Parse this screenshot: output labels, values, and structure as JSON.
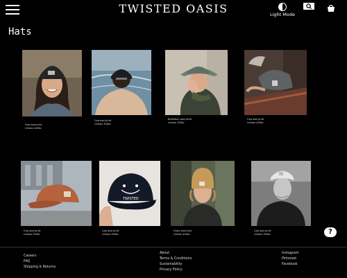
{
  "header": {
    "brand": "TWISTED OASIS",
    "light_mode_label": "Light Mode"
  },
  "page": {
    "title": "Hats"
  },
  "products": [
    {
      "line1": "Hue ead print",
      "line2": "Unisex 400kr."
    },
    {
      "line1": "Cap aad print",
      "line2": "Unisex 350kr."
    },
    {
      "line1": "Balliebun aad print",
      "line2": "Unisex 350kr."
    },
    {
      "line1": "Cap aad print",
      "line2": "Unisex 400kr."
    },
    {
      "line1": "Cap aad print",
      "line2": "Unisex 350kr."
    },
    {
      "line1": "Cap aad print",
      "line2": "Unisex 500kr."
    },
    {
      "line1": "Huey aad print",
      "line2": "Unisex 450kr."
    },
    {
      "line1": "Cap aad print",
      "line2": "Unisex 350kr."
    }
  ],
  "help": {
    "label": "?"
  },
  "footer": {
    "col1": [
      "Careers",
      "FAQ",
      "Shipping & Returns"
    ],
    "col2": [
      "About",
      "Terms & Conditions",
      "Sustainability",
      "Privacy Policy"
    ],
    "col3": [
      "Instagram",
      "Pinterest",
      "Facebook"
    ]
  },
  "colors": {
    "background": "#000000",
    "text": "#ffffff"
  },
  "icons": [
    "menu-icon",
    "theme-toggle-icon",
    "search-icon",
    "cart-icon"
  ]
}
